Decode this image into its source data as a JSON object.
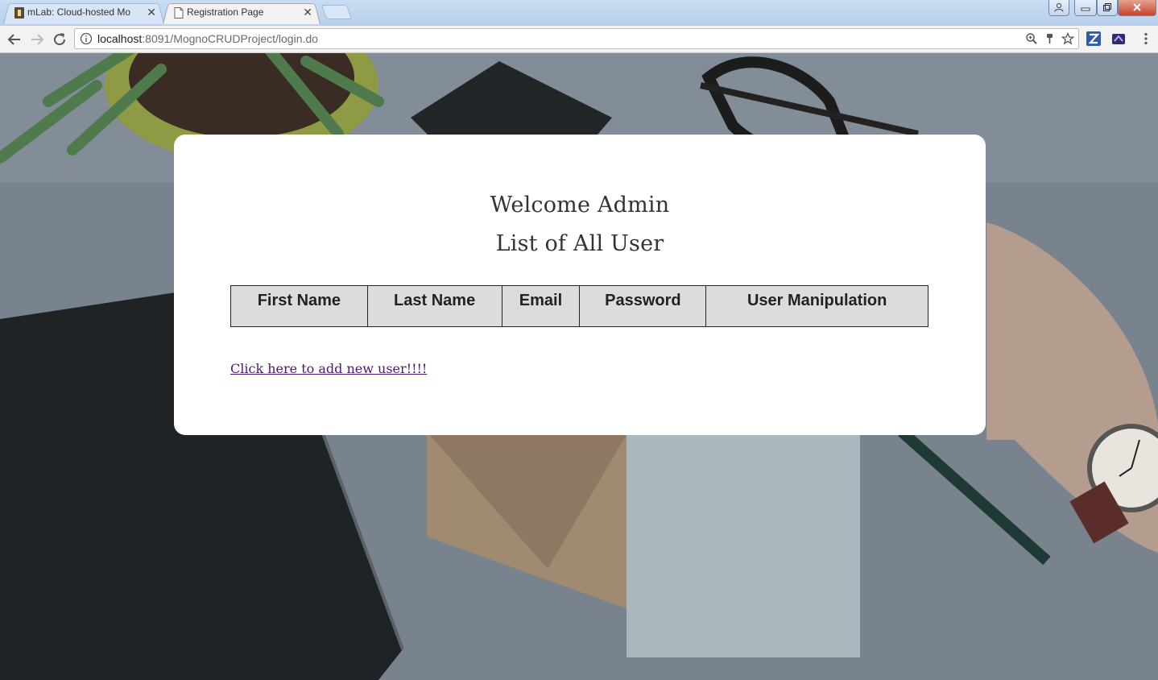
{
  "browser": {
    "tabs": [
      {
        "title": "mLab: Cloud-hosted Mo",
        "active": false
      },
      {
        "title": "Registration Page",
        "active": true
      }
    ],
    "url_host": "localhost",
    "url_rest": ":8091/MognoCRUDProject/login.do"
  },
  "page": {
    "heading": "Welcome Admin",
    "subheading": "List of All User",
    "table": {
      "columns": [
        "First Name",
        "Last Name",
        "Email",
        "Password",
        "User Manipulation"
      ],
      "rows": []
    },
    "add_user_link": "Click here to add new user!!!!"
  },
  "colors": {
    "link": "#4b1a6f",
    "table_header_bg": "#dcdcdc",
    "tabstrip": "#c9ddf3"
  }
}
